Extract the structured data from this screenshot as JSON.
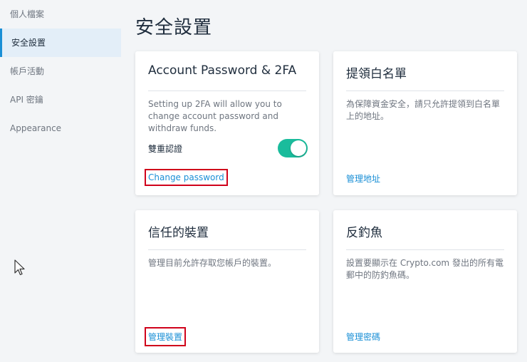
{
  "sidebar": {
    "items": [
      {
        "label": "個人檔案",
        "active": false
      },
      {
        "label": "安全設置",
        "active": true
      },
      {
        "label": "帳戶活動",
        "active": false
      },
      {
        "label": "API 密鑰",
        "active": false
      },
      {
        "label": "Appearance",
        "active": false
      }
    ]
  },
  "page": {
    "title": "安全設置"
  },
  "cards": {
    "account": {
      "title": "Account Password & 2FA",
      "description": "Setting up 2FA will allow you to change account password and withdraw funds.",
      "toggle_label": "雙重認證",
      "toggle_on": true,
      "link": "Change password"
    },
    "whitelist": {
      "title": "提領白名單",
      "description": "為保障資金安全，請只允許提領到白名單上的地址。",
      "link": "管理地址"
    },
    "devices": {
      "title": "信任的裝置",
      "description": "管理目前允許存取您帳戶的裝置。",
      "link": "管理裝置"
    },
    "antiphishing": {
      "title": "反釣魚",
      "description": "設置要顯示在 Crypto.com 發出的所有電郵中的防釣魚碼。",
      "link": "管理密碼"
    }
  },
  "colors": {
    "accent": "#1a8fd6",
    "toggle_on": "#1abc9c",
    "highlight": "#d0021b"
  }
}
